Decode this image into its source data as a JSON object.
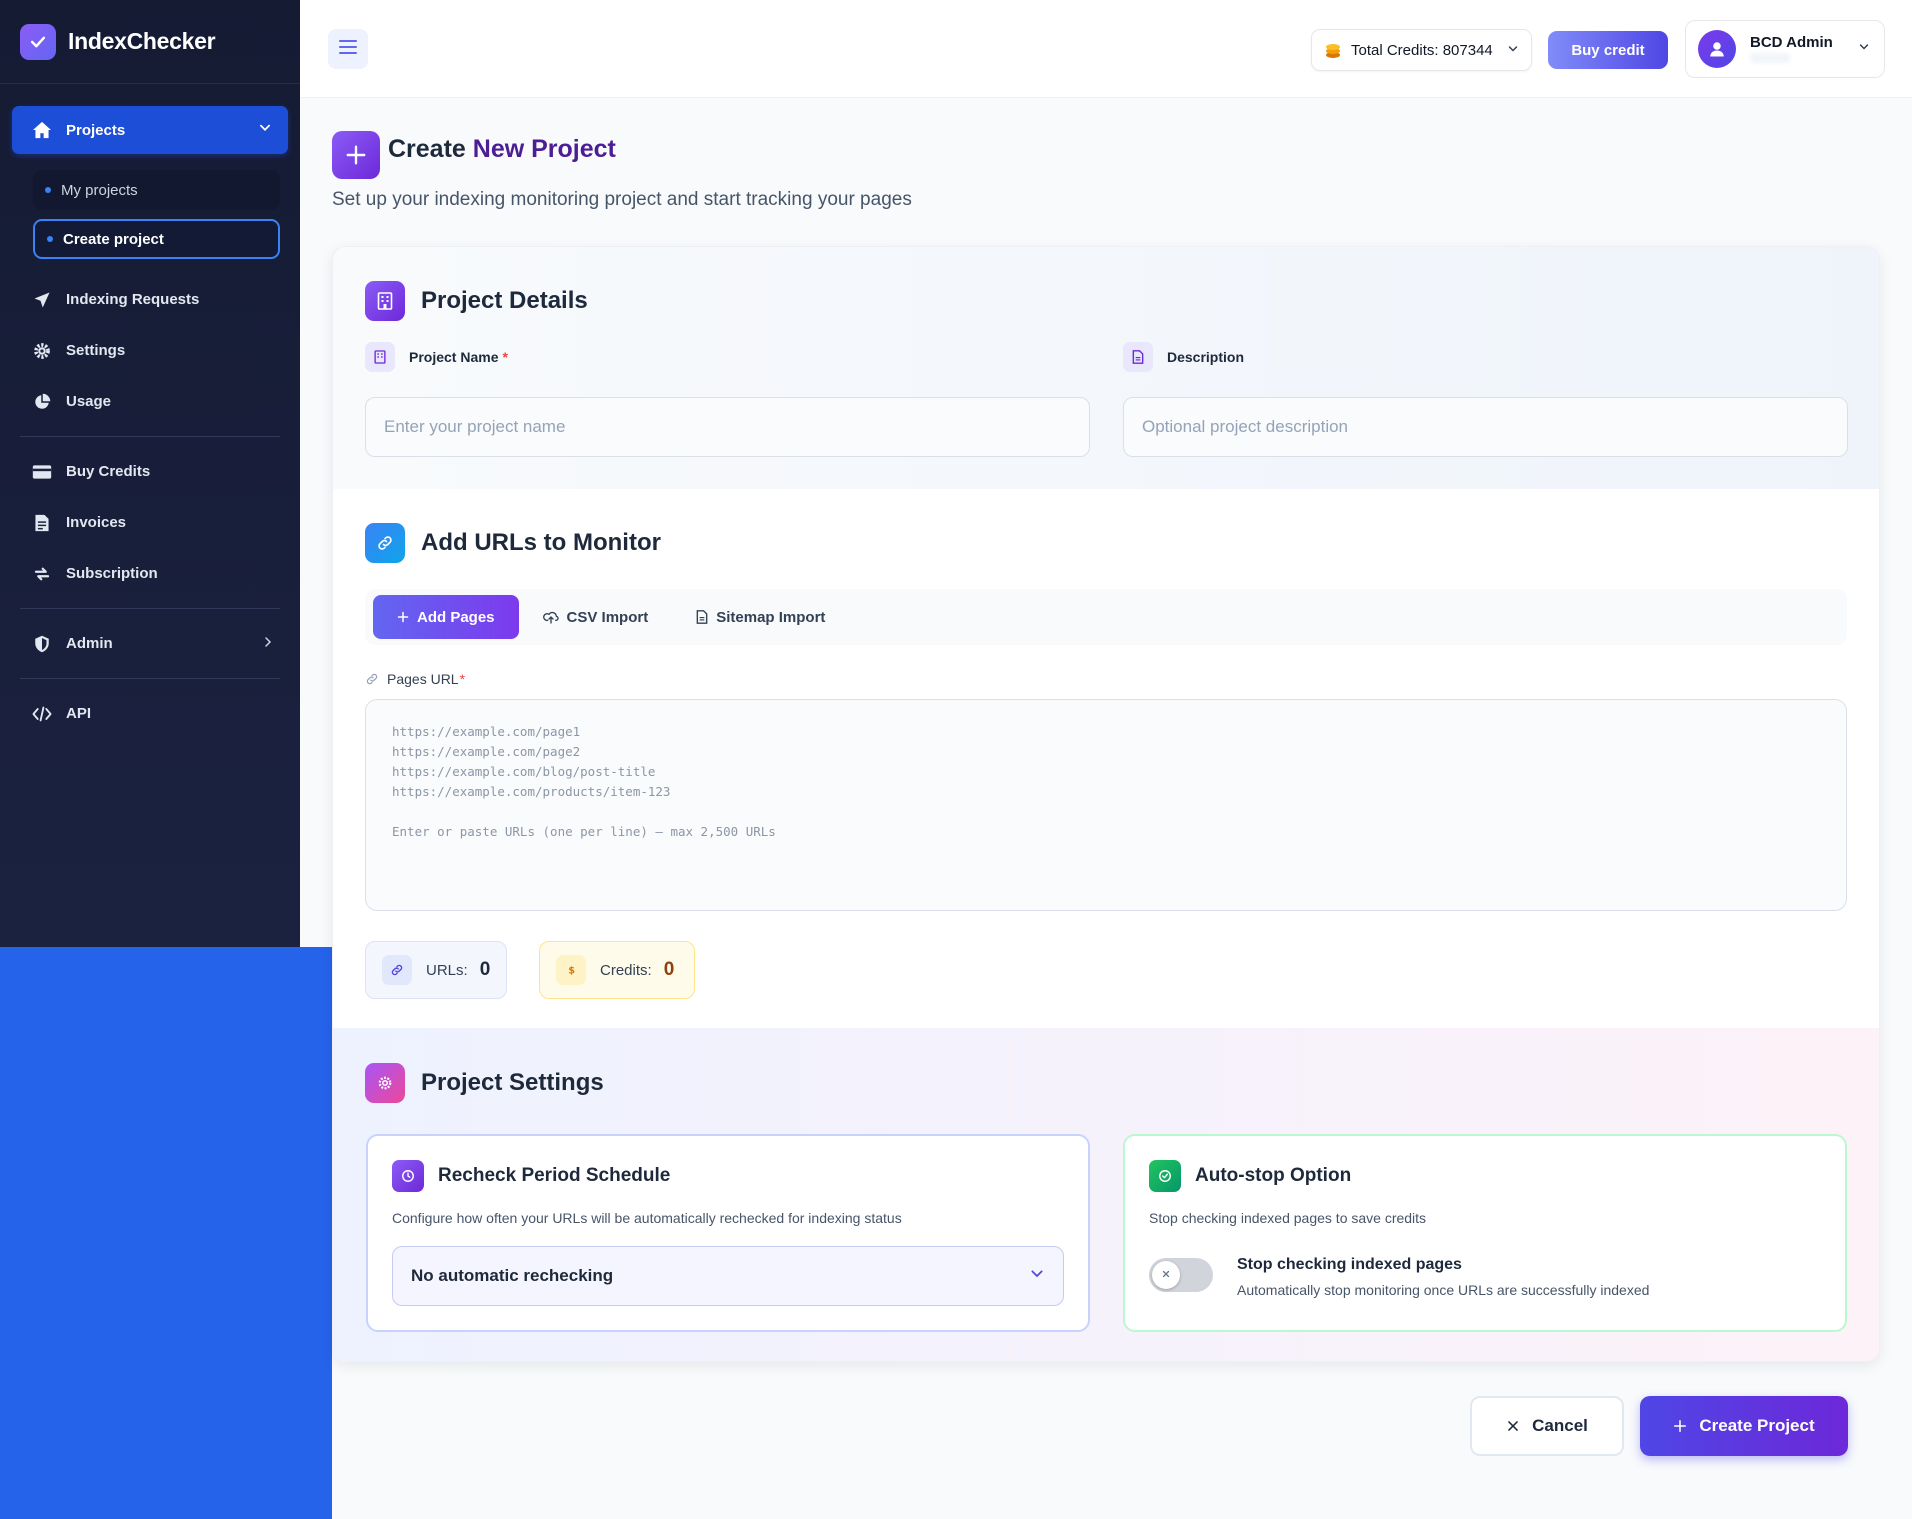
{
  "brand": {
    "name": "IndexChecker"
  },
  "sidebar": {
    "active": {
      "label": "Projects"
    },
    "sub_items": [
      {
        "label": "My projects"
      },
      {
        "label": "Create project"
      }
    ],
    "items_a": [
      {
        "label": "Indexing Requests",
        "icon": "send-icon"
      },
      {
        "label": "Settings",
        "icon": "gear-icon"
      },
      {
        "label": "Usage",
        "icon": "pie-chart-icon"
      }
    ],
    "items_b": [
      {
        "label": "Buy Credits",
        "icon": "credit-card-icon"
      },
      {
        "label": "Invoices",
        "icon": "invoice-icon"
      },
      {
        "label": "Subscription",
        "icon": "refresh-icon"
      }
    ],
    "admin": {
      "label": "Admin"
    },
    "api": {
      "label": "API"
    }
  },
  "topbar": {
    "credits_label": "Total Credits: 807344",
    "buy_label": "Buy credit",
    "user_name": "BCD Admin"
  },
  "page": {
    "title_prefix": "Create ",
    "title_accent": "New Project",
    "subtitle": "Set up your indexing monitoring project and start tracking your pages"
  },
  "details": {
    "title": "Project Details",
    "name_label": "Project Name",
    "name_required": "*",
    "name_placeholder": "Enter your project name",
    "desc_label": "Description",
    "desc_placeholder": "Optional project description"
  },
  "urls": {
    "title": "Add URLs to Monitor",
    "tabs": [
      {
        "label": "Add Pages"
      },
      {
        "label": "CSV Import"
      },
      {
        "label": "Sitemap Import"
      }
    ],
    "pages_label": "Pages URL",
    "pages_required": "*",
    "placeholder": "https://example.com/page1\nhttps://example.com/page2\nhttps://example.com/blog/post-title\nhttps://example.com/products/item-123\n\nEnter or paste URLs (one per line) — max 2,500 URLs",
    "urls_stat_label": "URLs:",
    "urls_stat_value": "0",
    "credits_stat_label": "Credits:",
    "credits_stat_value": "0"
  },
  "settings": {
    "title": "Project Settings",
    "recheck": {
      "title": "Recheck Period Schedule",
      "desc": "Configure how often your URLs will be automatically rechecked for indexing status",
      "selected": "No automatic rechecking"
    },
    "autostop": {
      "title": "Auto-stop Option",
      "desc": "Stop checking indexed pages to save credits",
      "toggle_title": "Stop checking indexed pages",
      "toggle_desc": "Automatically stop monitoring once URLs are successfully indexed",
      "enabled": false
    }
  },
  "actions": {
    "cancel": "Cancel",
    "create": "Create Project"
  },
  "colors": {
    "sidebar_bg": "#151b33",
    "primary": "#4f46e5",
    "accent_blue": "#1d4ed8",
    "success": "#22c55e"
  }
}
